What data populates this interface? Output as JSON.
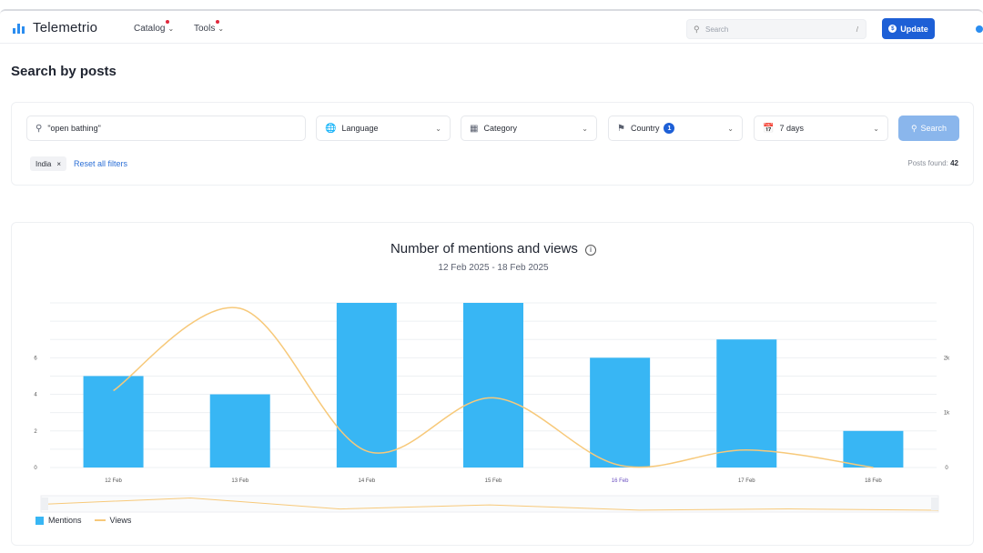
{
  "header": {
    "logo_text": "Telemetrio",
    "nav": [
      {
        "label": "Catalog"
      },
      {
        "label": "Tools"
      }
    ],
    "search_placeholder": "Search",
    "search_shortcut": "/",
    "update_label": "Update",
    "update_icon": "$"
  },
  "page": {
    "title": "Search by posts"
  },
  "filters": {
    "query": "\"open bathing\"",
    "language": "Language",
    "category": "Category",
    "country": "Country",
    "country_count": "1",
    "period": "7 days",
    "search_label": "Search",
    "chip_label": "India",
    "reset_label": "Reset all filters",
    "posts_found_label": "Posts found:",
    "posts_found_value": "42"
  },
  "chart": {
    "title": "Number of mentions and views",
    "subtitle": "12 Feb 2025 - 18 Feb 2025",
    "legend": {
      "mentions": "Mentions",
      "views": "Views"
    }
  },
  "chart_data": {
    "type": "bar",
    "categories": [
      "12 Feb",
      "13 Feb",
      "14 Feb",
      "15 Feb",
      "16 Feb",
      "17 Feb",
      "18 Feb"
    ],
    "series": [
      {
        "name": "Mentions",
        "type": "bar",
        "axis": "left",
        "color": "#38b6f4",
        "values": [
          5,
          4,
          9,
          9,
          6,
          7,
          2
        ]
      },
      {
        "name": "Views",
        "type": "line",
        "axis": "right",
        "color": "#f7c97a",
        "values": [
          1400,
          2900,
          300,
          1270,
          40,
          320,
          0
        ]
      }
    ],
    "y_left": {
      "ticks": [
        "0",
        "2",
        "4",
        "6"
      ],
      "range": [
        0,
        9
      ]
    },
    "y_right": {
      "ticks": [
        "0",
        "1k",
        "2k"
      ],
      "range": [
        0,
        3000
      ]
    },
    "grid": true,
    "legend_position": "bottom-left"
  }
}
